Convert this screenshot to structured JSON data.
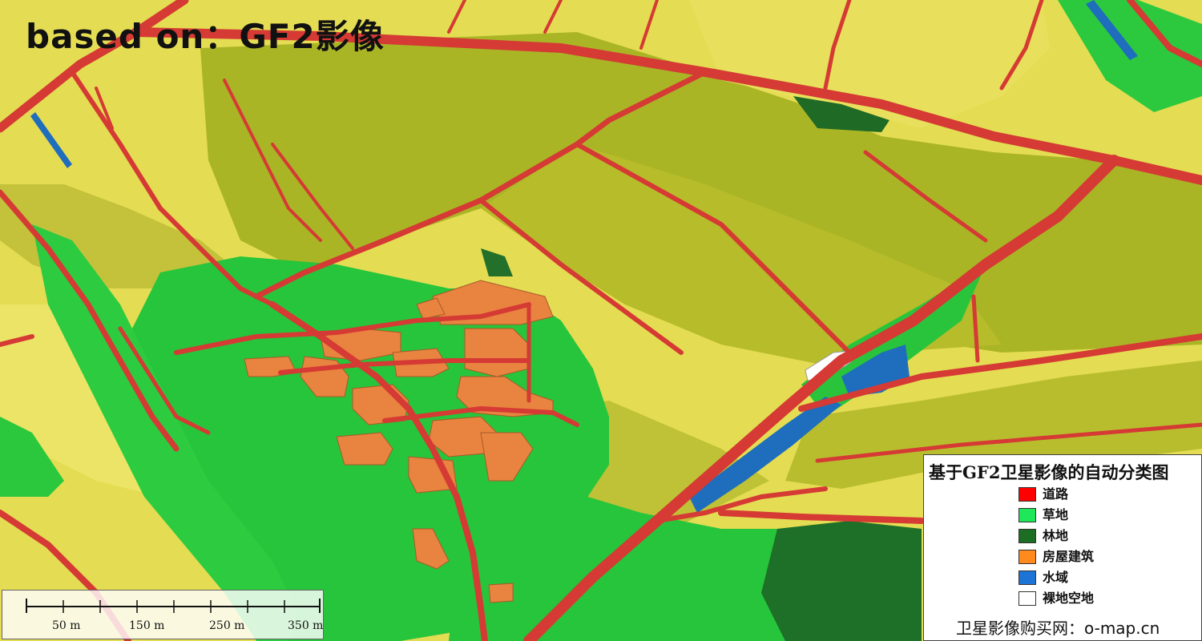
{
  "watermark": "based on：GF2影像",
  "colors": {
    "road": "#d63a36",
    "grassland": "#27c43a",
    "forest": "#1f7a2c",
    "building": "#e8853e",
    "water": "#1f6fbf",
    "bare": "#ffffff",
    "cropland_yellow": "#e6df55",
    "cropland_olive": "#a9b524"
  },
  "scale": {
    "labels": [
      "50 m",
      "150 m",
      "250 m",
      "350 m"
    ]
  },
  "legend": {
    "title": "基于GF2卫星影像的自动分类图",
    "items": [
      {
        "label": "道路",
        "color": "#ff0000"
      },
      {
        "label": "草地",
        "color": "#1ee85a"
      },
      {
        "label": "林地",
        "color": "#1d6e23"
      },
      {
        "label": "房屋建筑",
        "color": "#ff8a1e"
      },
      {
        "label": "水域",
        "color": "#1e74d6"
      },
      {
        "label": "裸地空地",
        "color": "#ffffff"
      }
    ],
    "footer": "卫星影像购买网：o-map.cn"
  }
}
